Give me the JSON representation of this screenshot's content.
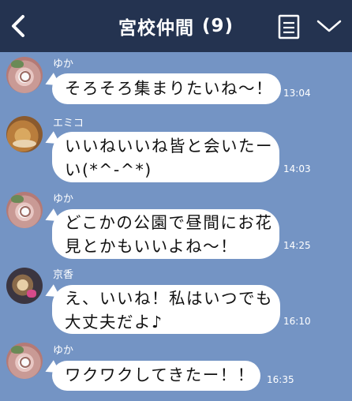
{
  "header": {
    "title": "宮校仲間",
    "member_count": "(9)"
  },
  "messages": [
    {
      "sender": "ゆか",
      "lines": [
        "そろそろ集まりたいね〜！"
      ],
      "time": "13:04"
    },
    {
      "sender": "エミコ",
      "lines": [
        "いいねいいね皆と会いたー",
        "い(*^-^*)"
      ],
      "time": "14:03"
    },
    {
      "sender": "ゆか",
      "lines": [
        "どこかの公園で昼間にお花",
        "見とかもいいよね〜！"
      ],
      "time": "14:25"
    },
    {
      "sender": "京香",
      "lines": [
        "え、いいね！私はいつでも",
        "大丈夫だよ♪"
      ],
      "time": "16:10"
    },
    {
      "sender": "ゆか",
      "lines": [
        "ワクワクしてきたー！！"
      ],
      "time": "16:35"
    }
  ]
}
